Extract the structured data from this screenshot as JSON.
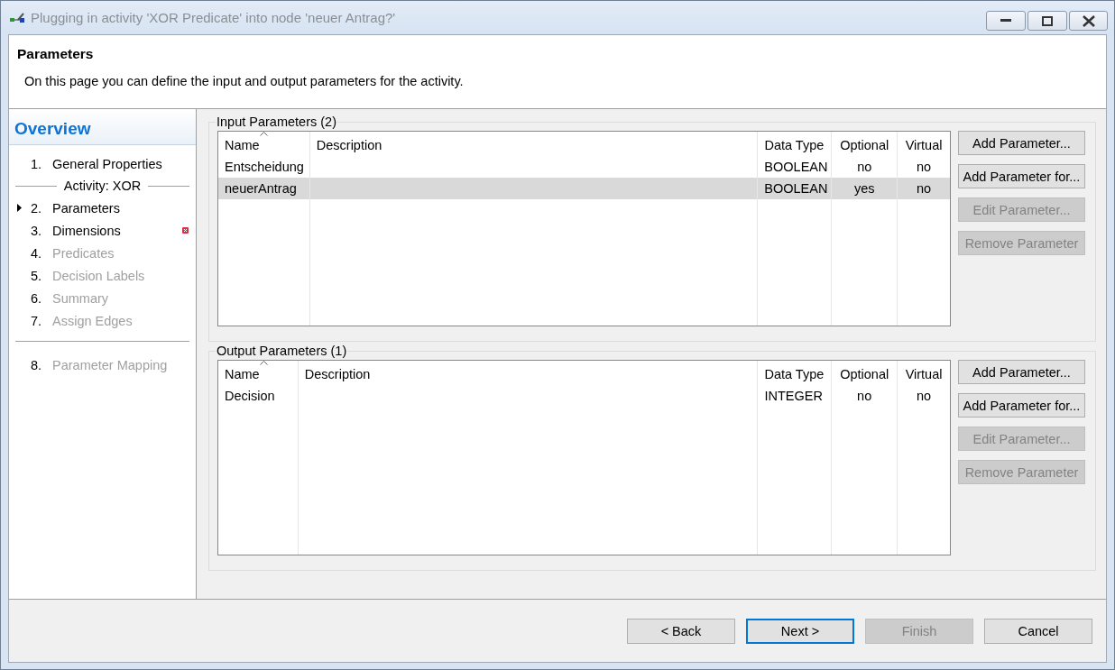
{
  "window": {
    "title": "Plugging in activity 'XOR Predicate' into node 'neuer Antrag?'"
  },
  "header": {
    "title": "Parameters",
    "description": "On this page you can define the input and output parameters for the activity."
  },
  "sidebar": {
    "title": "Overview",
    "items": [
      {
        "kind": "step",
        "number": "1.",
        "label": "General Properties",
        "selected": false,
        "disabled": false,
        "error": false
      },
      {
        "kind": "section",
        "label": "Activity: XOR"
      },
      {
        "kind": "step",
        "number": "2.",
        "label": "Parameters",
        "selected": true,
        "disabled": false,
        "error": false
      },
      {
        "kind": "step",
        "number": "3.",
        "label": "Dimensions",
        "selected": false,
        "disabled": false,
        "error": true
      },
      {
        "kind": "step",
        "number": "4.",
        "label": "Predicates",
        "selected": false,
        "disabled": true,
        "error": false
      },
      {
        "kind": "step",
        "number": "5.",
        "label": "Decision Labels",
        "selected": false,
        "disabled": true,
        "error": false
      },
      {
        "kind": "step",
        "number": "6.",
        "label": "Summary",
        "selected": false,
        "disabled": true,
        "error": false
      },
      {
        "kind": "step",
        "number": "7.",
        "label": "Assign Edges",
        "selected": false,
        "disabled": true,
        "error": false
      },
      {
        "kind": "divider"
      },
      {
        "kind": "step",
        "number": "8.",
        "label": "Parameter Mapping",
        "selected": false,
        "disabled": true,
        "error": false
      }
    ]
  },
  "groups": [
    {
      "title": "Input Parameters (2)",
      "columns": [
        "Name",
        "Description",
        "Data Type",
        "Optional",
        "Virtual"
      ],
      "rows": [
        {
          "cells": [
            "Entscheidung",
            "",
            "BOOLEAN",
            "no",
            "no"
          ],
          "selected": false
        },
        {
          "cells": [
            "neuerAntrag",
            "",
            "BOOLEAN",
            "yes",
            "no"
          ],
          "selected": true
        }
      ],
      "buttons": [
        {
          "label": "Add Parameter...",
          "disabled": false
        },
        {
          "label": "Add Parameter for...",
          "disabled": false
        },
        {
          "label": "Edit Parameter...",
          "disabled": true
        },
        {
          "label": "Remove Parameter",
          "disabled": true
        }
      ]
    },
    {
      "title": "Output Parameters (1)",
      "columns": [
        "Name",
        "Description",
        "Data Type",
        "Optional",
        "Virtual"
      ],
      "rows": [
        {
          "cells": [
            "Decision",
            "",
            "INTEGER",
            "no",
            "no"
          ],
          "selected": false
        }
      ],
      "buttons": [
        {
          "label": "Add Parameter...",
          "disabled": false
        },
        {
          "label": "Add Parameter for...",
          "disabled": false
        },
        {
          "label": "Edit Parameter...",
          "disabled": true
        },
        {
          "label": "Remove Parameter",
          "disabled": true
        }
      ]
    }
  ],
  "footer": {
    "buttons": [
      {
        "label": "< Back",
        "disabled": false,
        "default": false
      },
      {
        "label": "Next >",
        "disabled": false,
        "default": true
      },
      {
        "label": "Finish",
        "disabled": true,
        "default": false
      },
      {
        "label": "Cancel",
        "disabled": false,
        "default": false
      }
    ]
  }
}
